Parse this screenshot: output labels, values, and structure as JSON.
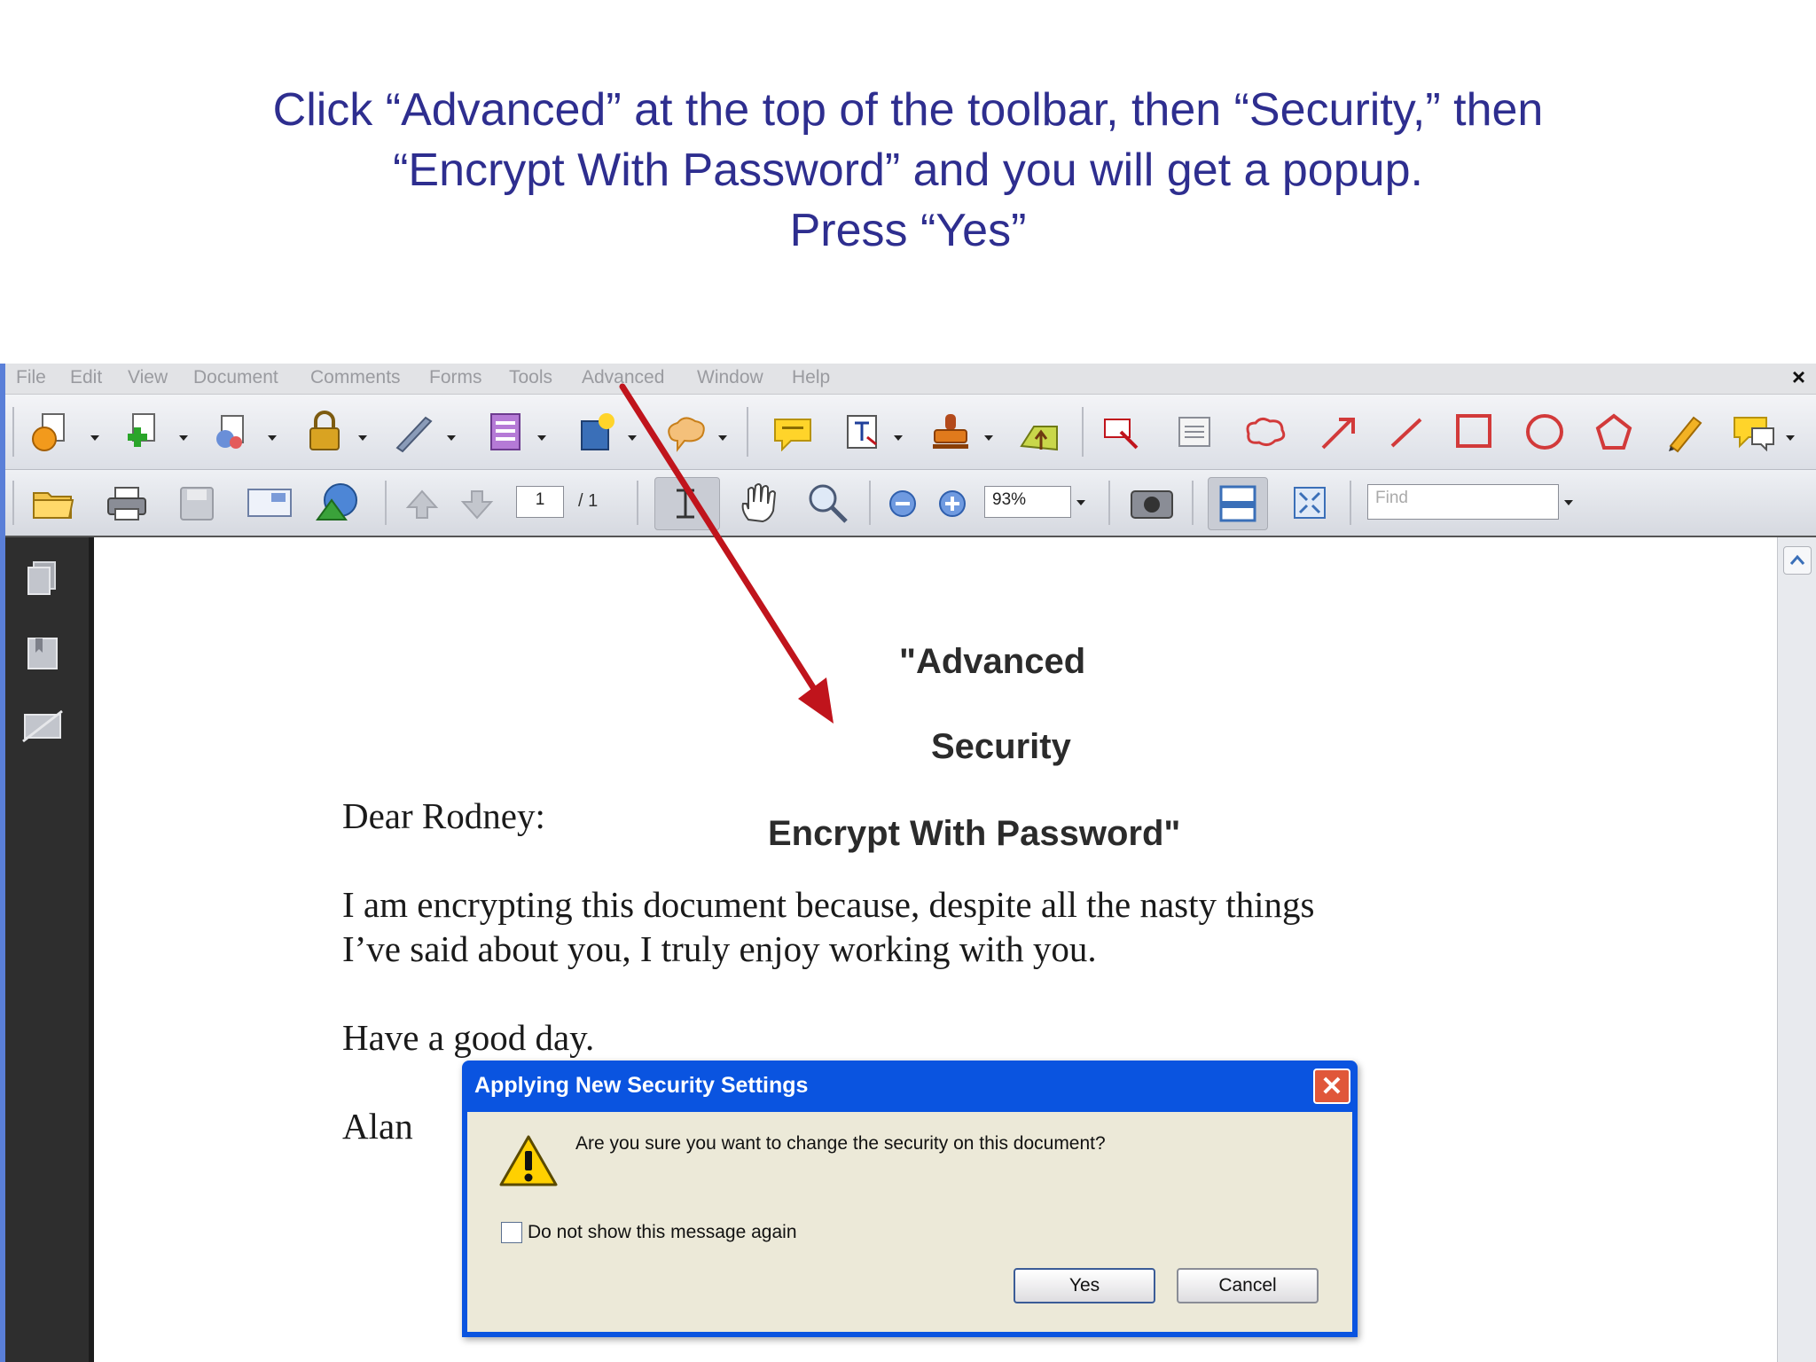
{
  "instruction": {
    "line1": "Click “Advanced” at the top of the toolbar, then “Security,” then",
    "line2": "“Encrypt With Password” and you will get a popup.",
    "line3": "Press “Yes”"
  },
  "menubar": {
    "items": [
      "File",
      "Edit",
      "View",
      "Document",
      "Comments",
      "Forms",
      "Tools",
      "Advanced",
      "Window",
      "Help"
    ],
    "close": "×"
  },
  "navigation": {
    "page_current": "1",
    "page_total": "/ 1",
    "zoom": "93%",
    "find_placeholder": "Find"
  },
  "overlay": {
    "line1": "\"Advanced",
    "line2": "Security",
    "line3": "Encrypt With Password\""
  },
  "letter": {
    "greeting": "Dear Rodney:",
    "body1": "I am encrypting this document because, despite all the nasty things",
    "body2": "I’ve said about you, I truly enjoy working with you.",
    "closing": "Have a good day.",
    "signature": "Alan"
  },
  "dialog": {
    "title": "Applying New Security Settings",
    "message": "Are you sure you want to change the security on this document?",
    "checkbox_label": "Do not show this message again",
    "checkbox_checked": false,
    "yes_label": "Yes",
    "cancel_label": "Cancel",
    "close": "✕"
  },
  "colors": {
    "instruction_text": "#2e2e8f",
    "dialog_titlebar": "#0a54e0",
    "dialog_body": "#ece9d8",
    "arrow": "#c0141c"
  }
}
